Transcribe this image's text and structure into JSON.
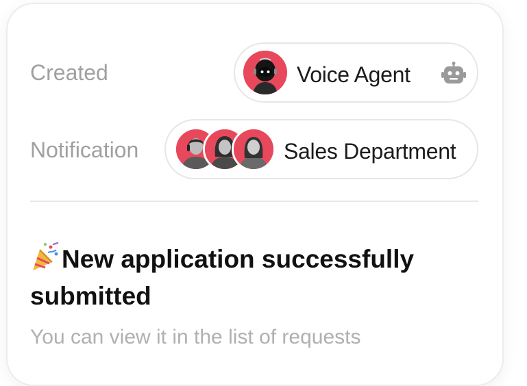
{
  "details": {
    "created_label": "Created",
    "created_value": "Voice Agent",
    "notification_label": "Notification",
    "notification_value": "Sales Department"
  },
  "message": {
    "title": "New application successfully submitted",
    "description": "You can view it in the list of requests"
  },
  "icons": {
    "agent_avatar": "robot-avatar",
    "agent_badge": "robot-icon",
    "team_avatars": [
      "person-avatar",
      "person-avatar",
      "person-avatar"
    ],
    "title_emoji": "party-popper-icon"
  },
  "colors": {
    "avatar_bg": "#e8485c",
    "label": "#a0a0a0",
    "text": "#1c1c1c"
  }
}
